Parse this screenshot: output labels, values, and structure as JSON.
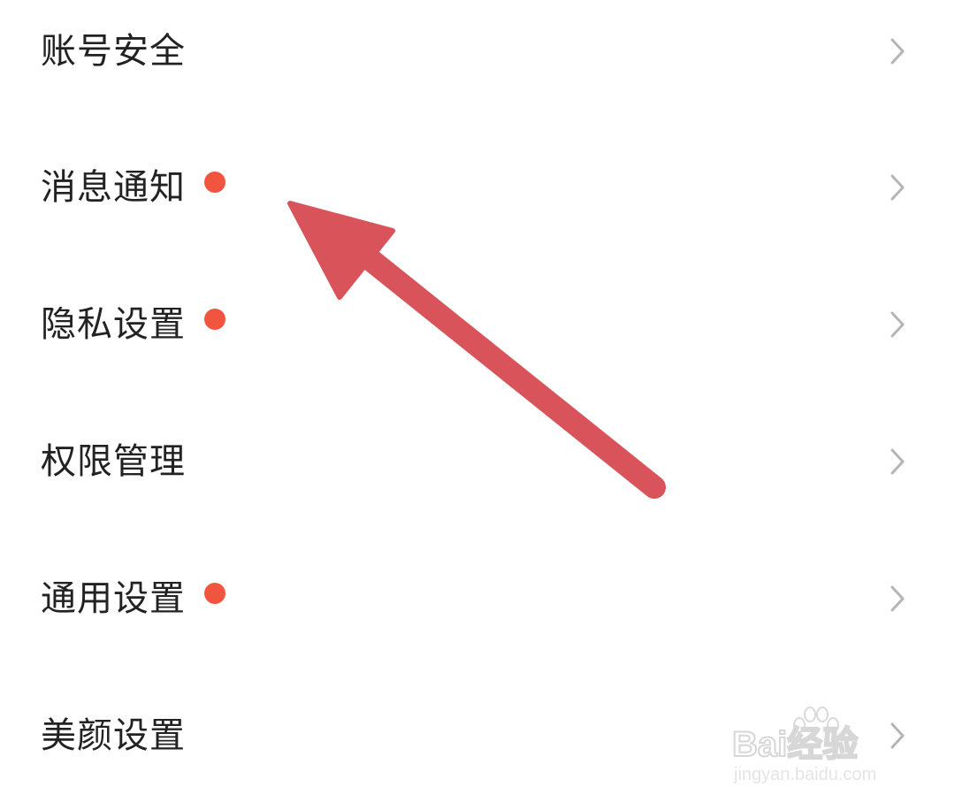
{
  "settings": {
    "items": [
      {
        "label": "账号安全",
        "has_badge": false
      },
      {
        "label": "消息通知",
        "has_badge": true
      },
      {
        "label": "隐私设置",
        "has_badge": true
      },
      {
        "label": "权限管理",
        "has_badge": false
      },
      {
        "label": "通用设置",
        "has_badge": true
      },
      {
        "label": "美颜设置",
        "has_badge": false
      }
    ],
    "chevron_icon": "chevron-right-icon",
    "badge_icon": "red-dot-badge"
  },
  "watermark": {
    "brand": "Bai经验",
    "url": "jingyan.baidu.com"
  },
  "colors": {
    "badge": "#f2553f",
    "arrow": "#d9535b",
    "chevron": "#b5b5b5",
    "text": "#222222",
    "background": "#ffffff"
  }
}
